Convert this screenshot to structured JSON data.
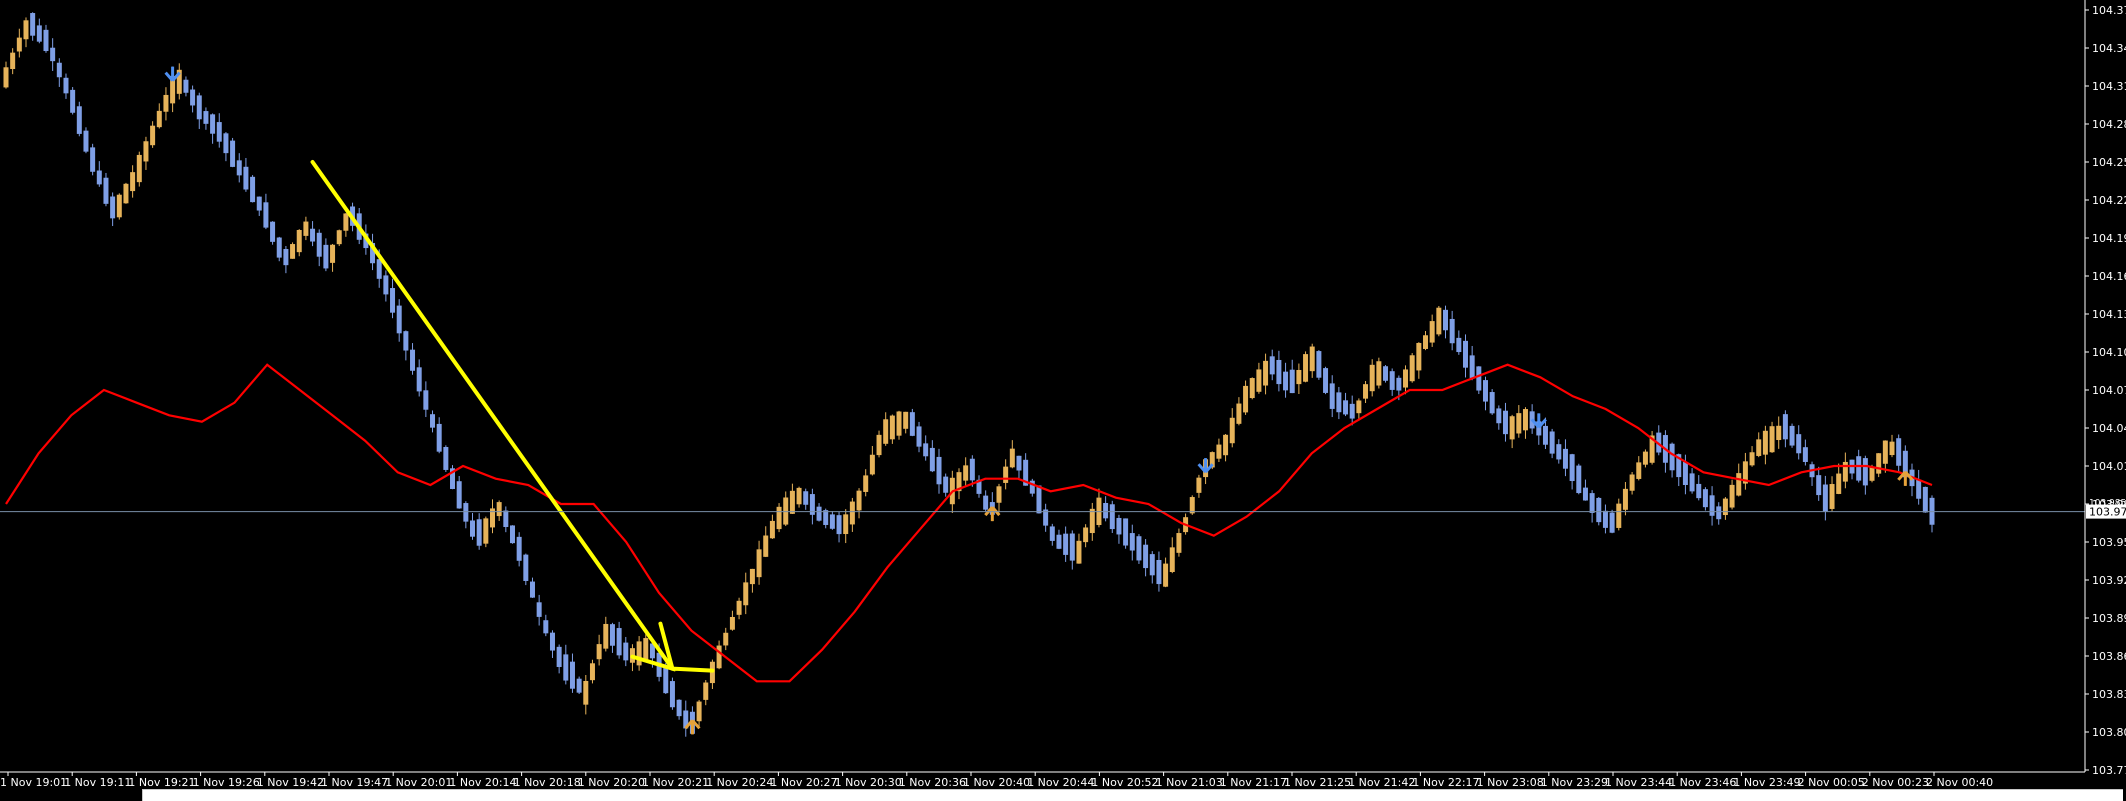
{
  "colors": {
    "background": "#000000",
    "bullish_candle": "#e6b35a",
    "bearish_candle": "#7f9fe6",
    "moving_average": "#ff0000",
    "trend_annotation": "#ffff00",
    "current_price_line": "#7a8fa8",
    "axis": "#ffffff",
    "buy_signal": "#e6a23a",
    "sell_signal": "#4f8ff0"
  },
  "chart_data": {
    "type": "candlestick",
    "ylim": [
      103.775,
      104.375
    ],
    "y_ticks": [
      "104.375",
      "104.345",
      "104.315",
      "104.285",
      "104.255",
      "104.225",
      "104.195",
      "104.165",
      "104.135",
      "104.105",
      "104.075",
      "104.045",
      "104.015",
      "103.985",
      "103.955",
      "103.925",
      "103.895",
      "103.865",
      "103.835",
      "103.805",
      "103.775"
    ],
    "x_ticks": [
      "1 Nov 19:01",
      "1 Nov 19:11",
      "1 Nov 19:21",
      "1 Nov 19:26",
      "1 Nov 19:42",
      "1 Nov 19:47",
      "1 Nov 20:01",
      "1 Nov 20:14",
      "1 Nov 20:18",
      "1 Nov 20:20",
      "1 Nov 20:21",
      "1 Nov 20:24",
      "1 Nov 20:27",
      "1 Nov 20:30",
      "1 Nov 20:36",
      "1 Nov 20:40",
      "1 Nov 20:44",
      "1 Nov 20:52",
      "1 Nov 21:03",
      "1 Nov 21:17",
      "1 Nov 21:25",
      "1 Nov 21:42",
      "1 Nov 22:17",
      "1 Nov 23:08",
      "1 Nov 23:29",
      "1 Nov 23:44",
      "1 Nov 23:46",
      "1 Nov 23:49",
      "2 Nov 00:05",
      "2 Nov 00:23",
      "2 Nov 00:40"
    ],
    "current_price": 103.979,
    "current_price_label": "103.979",
    "current_price_label_behind": "103.985",
    "price_path": [
      104.325,
      104.365,
      104.345,
      104.305,
      104.255,
      104.215,
      104.245,
      104.285,
      104.325,
      104.295,
      104.275,
      104.245,
      104.215,
      104.175,
      104.205,
      104.175,
      104.215,
      104.185,
      104.145,
      104.095,
      104.045,
      103.995,
      103.955,
      103.985,
      103.945,
      103.895,
      103.855,
      103.835,
      103.885,
      103.865,
      103.875,
      103.835,
      103.805,
      103.855,
      103.895,
      103.935,
      103.975,
      103.995,
      103.975,
      103.965,
      103.995,
      104.045,
      104.055,
      104.025,
      103.995,
      104.015,
      103.975,
      104.025,
      103.995,
      103.955,
      103.945,
      103.985,
      103.965,
      103.945,
      103.925,
      103.965,
      104.015,
      104.035,
      104.075,
      104.095,
      104.075,
      104.105,
      104.065,
      104.055,
      104.095,
      104.075,
      104.105,
      104.135,
      104.105,
      104.075,
      104.045,
      104.055,
      104.035,
      104.015,
      103.985,
      103.965,
      104.005,
      104.035,
      104.015,
      103.995,
      103.975,
      104.005,
      104.035,
      104.045,
      104.025,
      103.985,
      104.015,
      104.005,
      104.035,
      104.005,
      103.975
    ],
    "ma_path": [
      103.985,
      104.025,
      104.055,
      104.075,
      104.065,
      104.055,
      104.05,
      104.065,
      104.095,
      104.075,
      104.055,
      104.035,
      104.01,
      104.0,
      104.015,
      104.005,
      104.0,
      103.985,
      103.985,
      103.955,
      103.915,
      103.885,
      103.865,
      103.845,
      103.845,
      103.87,
      103.9,
      103.935,
      103.965,
      103.995,
      104.005,
      104.005,
      103.995,
      104.0,
      103.99,
      103.985,
      103.97,
      103.96,
      103.975,
      103.995,
      104.025,
      104.045,
      104.06,
      104.075,
      104.075,
      104.085,
      104.095,
      104.085,
      104.07,
      104.06,
      104.045,
      104.025,
      104.01,
      104.005,
      104.0,
      104.01,
      104.015,
      104.015,
      104.01,
      104.0
    ],
    "ma_x": [
      0,
      20,
      40,
      60,
      80,
      100,
      120,
      140,
      160,
      180,
      200,
      220,
      240,
      260,
      280,
      300,
      320,
      340,
      360,
      380,
      400,
      420,
      440,
      460,
      480,
      500,
      520,
      540,
      560,
      580,
      600,
      620,
      640,
      660,
      680,
      700,
      720,
      740,
      760,
      780,
      800,
      820,
      840,
      860,
      880,
      900,
      920,
      940,
      960,
      980,
      1000,
      1020,
      1040,
      1060,
      1080,
      1100,
      1120,
      1140,
      1160,
      1180
    ],
    "signals": [
      {
        "type": "sell",
        "index": 25
      },
      {
        "type": "buy",
        "index": 103
      },
      {
        "type": "buy",
        "index": 148
      },
      {
        "type": "sell",
        "index": 180
      },
      {
        "type": "sell",
        "index": 230
      },
      {
        "type": "buy",
        "index": 285
      }
    ],
    "trend_arrow": {
      "from": [
        104.255,
        46
      ],
      "to": [
        103.855,
        100
      ]
    }
  }
}
